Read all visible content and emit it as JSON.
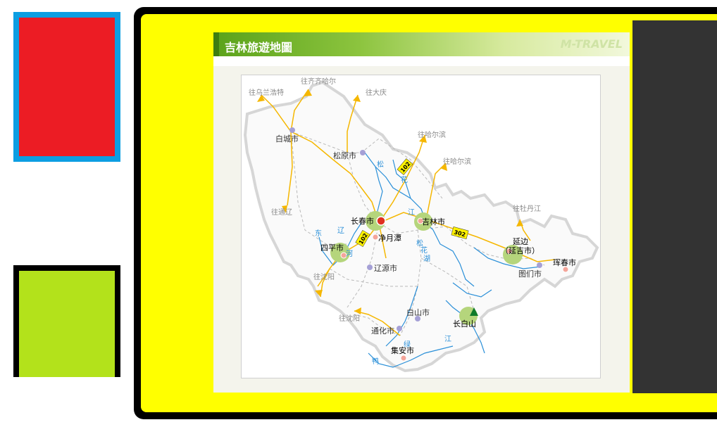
{
  "header": {
    "title": "吉林旅遊地圖",
    "brand": "M-TRAVEL"
  },
  "map": {
    "cities": [
      {
        "name": "白城市"
      },
      {
        "name": "松原市"
      },
      {
        "name": "长春市"
      },
      {
        "name": "吉林市"
      },
      {
        "name": "净月潭"
      },
      {
        "name": "四平市"
      },
      {
        "name": "辽源市"
      },
      {
        "name": "延边"
      },
      {
        "name": "（延吉市）"
      },
      {
        "name": "珲春市"
      },
      {
        "name": "图们市"
      },
      {
        "name": "白山市"
      },
      {
        "name": "长白山"
      },
      {
        "name": "通化市"
      },
      {
        "name": "集安市"
      }
    ],
    "directions": [
      {
        "name": "往乌兰浩特"
      },
      {
        "name": "往齐齐哈尔"
      },
      {
        "name": "往大庆"
      },
      {
        "name": "往哈尔滨"
      },
      {
        "name": "往哈尔滨"
      },
      {
        "name": "往通辽"
      },
      {
        "name": "往沈阳"
      },
      {
        "name": "往沈阳"
      },
      {
        "name": "往牡丹江"
      }
    ],
    "rivers": [
      {
        "name": "松"
      },
      {
        "name": "花"
      },
      {
        "name": "江"
      },
      {
        "name": "东"
      },
      {
        "name": "辽"
      },
      {
        "name": "河"
      },
      {
        "name": "松"
      },
      {
        "name": "花"
      },
      {
        "name": "湖"
      },
      {
        "name": "鸭"
      },
      {
        "name": "绿"
      },
      {
        "name": "江"
      }
    ],
    "roads": [
      {
        "name": "102"
      },
      {
        "name": "302"
      },
      {
        "name": "102"
      }
    ]
  }
}
